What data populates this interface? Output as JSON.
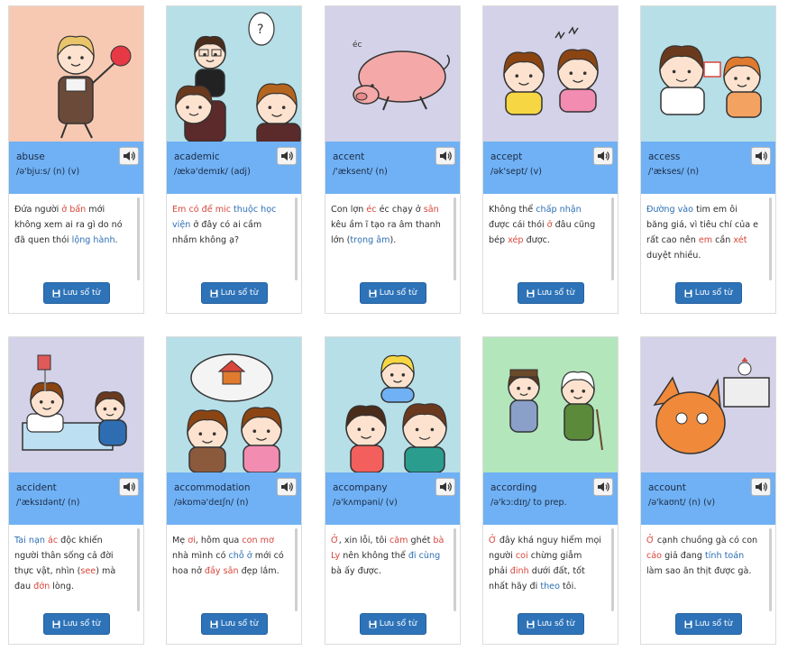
{
  "save_label": "Lưu sổ từ",
  "icons": {
    "audio": "volume-up-icon",
    "save": "floppy-disk-icon"
  },
  "colors": {
    "wordbar": "#6fb1f4",
    "button": "#2e73b8",
    "highlight_red": "#d9463b",
    "highlight_blue": "#2d6fb5"
  },
  "cards": [
    {
      "word": "abuse",
      "phonetic": "/ə'bju:s/ (n) (v)",
      "illus_bg": "#f7c9b3",
      "example": [
        [
          "Đứa người ",
          ""
        ],
        [
          "ở bẩn",
          "r"
        ],
        [
          " mới không xem ai ra gì do nó đã quen thói ",
          ""
        ],
        [
          "lộng hành",
          "b"
        ],
        [
          ".",
          ""
        ]
      ]
    },
    {
      "word": "academic",
      "phonetic": "/ækə'demɪk/ (adj)",
      "illus_bg": "#b7dfe8",
      "example": [
        [
          "Em có để mic",
          "r"
        ],
        [
          " ",
          ""
        ],
        [
          "thuộc học viện",
          "b"
        ],
        [
          " ở đây có ai cầm nhầm không ạ?",
          ""
        ]
      ]
    },
    {
      "word": "accent",
      "phonetic": "/'æksent/ (n)",
      "illus_bg": "#d3d2e8",
      "example": [
        [
          "Con lợn ",
          ""
        ],
        [
          "éc",
          "r"
        ],
        [
          " éc chạy ở ",
          ""
        ],
        [
          "sân",
          "r"
        ],
        [
          " kêu ầm ĩ tạo ra âm thanh lớn (",
          ""
        ],
        [
          "trọng âm",
          "b"
        ],
        [
          ").",
          ""
        ]
      ]
    },
    {
      "word": "accept",
      "phonetic": "/ək'sept/ (v)",
      "illus_bg": "#d3d2e8",
      "example": [
        [
          "Không thể ",
          ""
        ],
        [
          "chấp nhận",
          "b"
        ],
        [
          " được cái thói ",
          ""
        ],
        [
          "ở",
          "r"
        ],
        [
          " đâu cũng bép ",
          ""
        ],
        [
          "xép",
          "r"
        ],
        [
          " được.",
          ""
        ]
      ]
    },
    {
      "word": "access",
      "phonetic": "/'ækses/ (n)",
      "illus_bg": "#b7dfe8",
      "example": [
        [
          "Đường vào",
          "b"
        ],
        [
          " tim em ôi băng giá, vì tiêu chí của e rất cao nên ",
          ""
        ],
        [
          "em",
          "r"
        ],
        [
          " cần ",
          ""
        ],
        [
          "xét",
          "r"
        ],
        [
          " duyệt nhiều.",
          ""
        ]
      ]
    },
    {
      "word": "accident",
      "phonetic": "/'æksɪdənt/ (n)",
      "illus_bg": "#d3d2e8",
      "example": [
        [
          "Tai nạn",
          "b"
        ],
        [
          " ",
          ""
        ],
        [
          "ác",
          "r"
        ],
        [
          " độc khiến người thân sống cả đời thực vật, nhìn (",
          ""
        ],
        [
          "see",
          "r"
        ],
        [
          ") mà đau ",
          ""
        ],
        [
          "đớn",
          "r"
        ],
        [
          " lòng.",
          ""
        ]
      ]
    },
    {
      "word": "accommodation",
      "phonetic": "/əkɒmə'deɪʃn/ (n)",
      "illus_bg": "#b7dfe8",
      "example": [
        [
          "Mẹ ",
          ""
        ],
        [
          "ơi",
          "r"
        ],
        [
          ", hôm qua ",
          ""
        ],
        [
          "con mơ",
          "r"
        ],
        [
          " nhà mình có ",
          ""
        ],
        [
          "chỗ ở",
          "b"
        ],
        [
          " mới có hoa nở ",
          ""
        ],
        [
          "đầy sân",
          "r"
        ],
        [
          " đẹp lắm.",
          ""
        ]
      ]
    },
    {
      "word": "accompany",
      "phonetic": "/ə'kʌmpəni/ (v)",
      "illus_bg": "#b7dfe8",
      "example": [
        [
          "Ở",
          "r"
        ],
        [
          ", xin lỗi, tôi ",
          ""
        ],
        [
          "căm",
          "r"
        ],
        [
          " ghét ",
          ""
        ],
        [
          "bà Ly",
          "r"
        ],
        [
          " nên không thể ",
          ""
        ],
        [
          "đi cùng",
          "b"
        ],
        [
          " bà ấy được.",
          ""
        ]
      ]
    },
    {
      "word": "according",
      "phonetic": "/ə'kɔ:dɪŋ/ to prep.",
      "illus_bg": "#b4e6bc",
      "example": [
        [
          "Ở",
          "r"
        ],
        [
          " đây khá nguy hiểm mọi người ",
          ""
        ],
        [
          "coi",
          "r"
        ],
        [
          " chừng giẫm phải ",
          ""
        ],
        [
          "đinh",
          "r"
        ],
        [
          " dưới đất, tốt nhất hãy đi ",
          ""
        ],
        [
          "theo",
          "b"
        ],
        [
          " tôi.",
          ""
        ]
      ]
    },
    {
      "word": "account",
      "phonetic": "/ə'kaʊnt/ (n) (v)",
      "illus_bg": "#d3d2e8",
      "example": [
        [
          "Ở",
          "r"
        ],
        [
          " cạnh chuồng gà có con ",
          ""
        ],
        [
          "cáo",
          "r"
        ],
        [
          " giả đang ",
          ""
        ],
        [
          "tính toán",
          "b"
        ],
        [
          " làm sao ăn thịt được gà.",
          ""
        ]
      ]
    }
  ]
}
